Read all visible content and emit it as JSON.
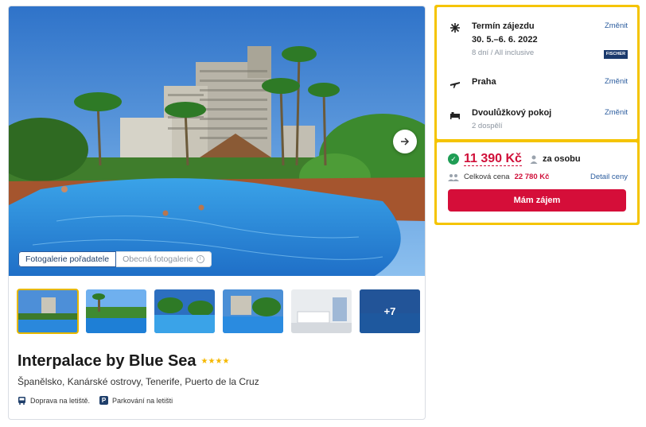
{
  "hotel": {
    "name": "Interpalace by Blue Sea",
    "stars": "★★★★",
    "location": "Španělsko, Kanárské ostrovy, Tenerife, Puerto de la Cruz",
    "amenities": [
      "Doprava na letiště.",
      "Parkování na letišti"
    ]
  },
  "gallery": {
    "tabs": [
      "Fotogalerie pořadatele",
      "Obecná fotogalerie"
    ],
    "active_tab": 0,
    "more_photos": "+7",
    "next_icon": "arrow-right-icon"
  },
  "trip": {
    "term_label": "Termín zájezdu",
    "dates": "30. 5.–6. 6. 2022",
    "duration": "8 dní / All inclusive",
    "organizer_logo_text": "FISCHER",
    "departure": "Praha",
    "room": "Dvoulůžkový pokoj",
    "guests": "2 dospělí",
    "change_label": "Změnit"
  },
  "pricing": {
    "price_per_person": "11 390 Kč",
    "per_person_label": "za osobu",
    "total_label": "Celková cena",
    "total_value": "22 780 Kč",
    "detail_link": "Detail ceny",
    "cta": "Mám zájem"
  },
  "colors": {
    "accent_yellow": "#f5c400",
    "price_red": "#d0103a",
    "cta_red": "#d50e39",
    "link_blue": "#2b5c9e"
  }
}
